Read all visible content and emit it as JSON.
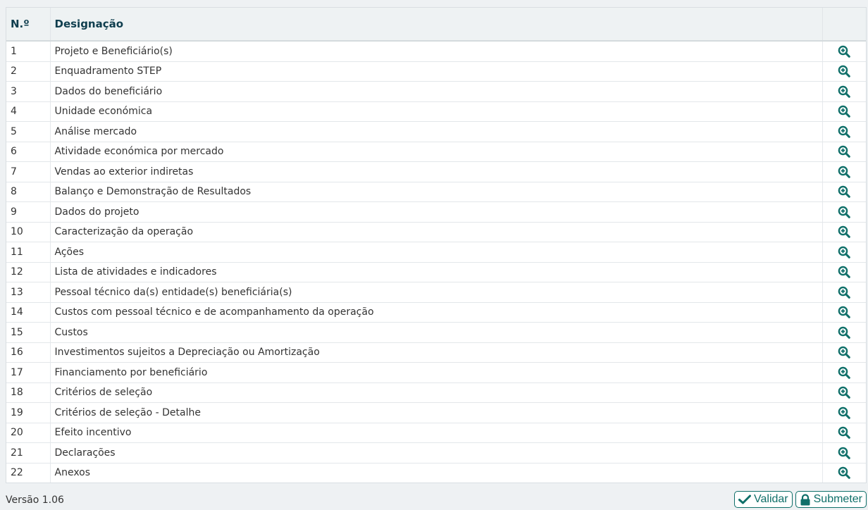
{
  "colors": {
    "accent": "#0f6f69",
    "header_text": "#0f3e4e",
    "header_bg": "#eef2f3"
  },
  "table": {
    "headers": {
      "num": "N.º",
      "designation": "Designação",
      "actions": ""
    },
    "rows": [
      {
        "num": "1",
        "label": "Projeto e Beneficiário(s)",
        "icon": "zoom-in-icon"
      },
      {
        "num": "2",
        "label": "Enquadramento STEP",
        "icon": "zoom-in-icon"
      },
      {
        "num": "3",
        "label": "Dados do beneficiário",
        "icon": "zoom-in-icon"
      },
      {
        "num": "4",
        "label": "Unidade económica",
        "icon": "zoom-in-icon"
      },
      {
        "num": "5",
        "label": "Análise mercado",
        "icon": "zoom-in-icon"
      },
      {
        "num": "6",
        "label": "Atividade económica por mercado",
        "icon": "zoom-in-icon"
      },
      {
        "num": "7",
        "label": "Vendas ao exterior indiretas",
        "icon": "zoom-in-icon"
      },
      {
        "num": "8",
        "label": "Balanço e Demonstração de Resultados",
        "icon": "zoom-in-icon"
      },
      {
        "num": "9",
        "label": "Dados do projeto",
        "icon": "zoom-in-icon"
      },
      {
        "num": "10",
        "label": "Caracterização da operação",
        "icon": "zoom-in-icon"
      },
      {
        "num": "11",
        "label": "Ações",
        "icon": "zoom-in-icon"
      },
      {
        "num": "12",
        "label": "Lista de atividades e indicadores",
        "icon": "zoom-in-icon"
      },
      {
        "num": "13",
        "label": "Pessoal técnico da(s) entidade(s) beneficiária(s)",
        "icon": "zoom-in-icon"
      },
      {
        "num": "14",
        "label": "Custos com pessoal técnico e de acompanhamento da operação",
        "icon": "zoom-in-icon"
      },
      {
        "num": "15",
        "label": "Custos",
        "icon": "zoom-in-icon"
      },
      {
        "num": "16",
        "label": "Investimentos sujeitos a Depreciação ou Amortização",
        "icon": "zoom-in-icon"
      },
      {
        "num": "17",
        "label": "Financiamento por beneficiário",
        "icon": "zoom-in-icon"
      },
      {
        "num": "18",
        "label": "Critérios de seleção",
        "icon": "zoom-in-icon"
      },
      {
        "num": "19",
        "label": "Critérios de seleção - Detalhe",
        "icon": "zoom-in-icon"
      },
      {
        "num": "20",
        "label": "Efeito incentivo",
        "icon": "zoom-in-icon"
      },
      {
        "num": "21",
        "label": "Declarações",
        "icon": "zoom-in-icon"
      },
      {
        "num": "22",
        "label": "Anexos",
        "icon": "zoom-in-icon"
      }
    ]
  },
  "footer": {
    "version": "Versão 1.06",
    "validate_label": "Validar",
    "validate_icon": "check-icon",
    "submit_label": "Submeter",
    "submit_icon": "lock-icon"
  }
}
